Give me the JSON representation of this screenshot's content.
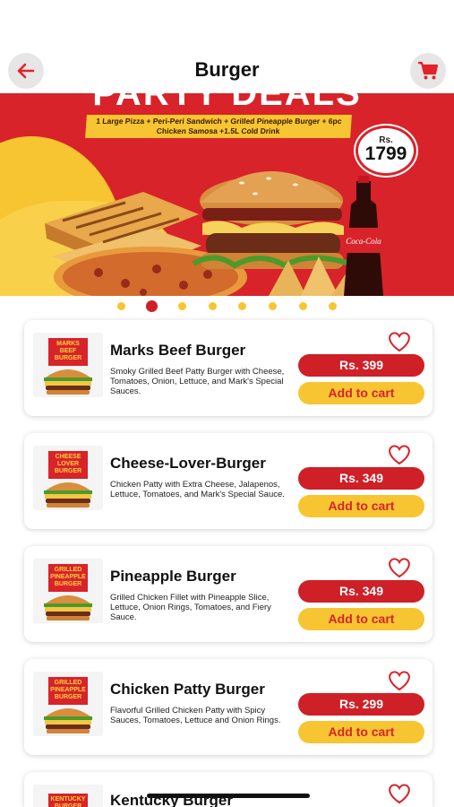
{
  "header": {
    "title": "Burger",
    "back_icon": "arrow-left-icon",
    "cart_icon": "shopping-cart-icon",
    "accent_color": "#e2232a"
  },
  "banner": {
    "headline": "PARTY DEALS",
    "items_text": "1 Large Pizza + Peri-Peri Sandwich + Grilled Pineapple Burger + 6pc Chicken Samosa +1.5L Cold Drink",
    "currency": "Rs.",
    "price": "1799",
    "bottle_brand": "Coca-Cola"
  },
  "carousel": {
    "slide_count": 8,
    "active_index": 1
  },
  "products": [
    {
      "name": "Marks Beef Burger",
      "image_label": "MARKS BEEF BURGER",
      "description": "Smoky Grilled Beef Patty Burger with Cheese, Tomatoes, Onion, Lettuce, and Mark's Special Sauces.",
      "price": "Rs. 399",
      "cta": "Add to cart"
    },
    {
      "name": "Cheese-Lover-Burger",
      "image_label": "CHEESE LOVER BURGER",
      "description": "Chicken Patty with Extra Cheese, Jalapenos, Lettuce, Tomatoes, and Mark's Special Sauce.",
      "price": "Rs. 349",
      "cta": "Add to cart"
    },
    {
      "name": "Pineapple Burger",
      "image_label": "GRILLED PINEAPPLE BURGER",
      "description": "Grilled Chicken Fillet with Pineapple Slice, Lettuce, Onion Rings, Tomatoes, and Fiery Sauce.",
      "price": "Rs. 349",
      "cta": "Add to cart"
    },
    {
      "name": "Chicken Patty Burger",
      "image_label": "GRILLED PINEAPPLE BURGER",
      "description": "Flavorful Grilled Chicken Patty with Spicy Sauces, Tomatoes, Lettuce and Onion Rings.",
      "price": "Rs. 299",
      "cta": "Add to cart"
    },
    {
      "name": "Kentucky Burger",
      "image_label": "KENTUCKY BURGER"
    }
  ]
}
